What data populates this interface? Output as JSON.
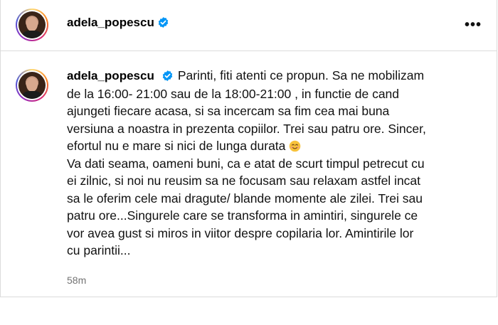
{
  "header": {
    "username": "adela_popescu",
    "more_label": "•••"
  },
  "post": {
    "username": "adela_popescu",
    "caption_lines": [
      "Parinti, fiti atenti ce propun. Sa ne mobilizam",
      "de la 16:00- 21:00 sau de la 18:00-21:00 , in functie de cand",
      "ajungeti fiecare acasa, si sa incercam sa fim cea mai buna",
      "versiuna a noastra in prezenta copiilor. Trei sau patru ore. Sincer,",
      "efortul nu e mare si nici de lunga durata",
      "Va dati seama, oameni buni, ca e atat de scurt timpul petrecut cu",
      "ei zilnic, si noi nu reusim sa ne focusam sau relaxam astfel incat",
      "sa le oferim cele mai dragute/ blande momente ale zilei. Trei sau",
      "patru ore...Singurele care se transforma in amintiri, singurele ce",
      "vor avea gust si miros in viitor despre copilaria lor. Amintirile lor",
      "cu parintii..."
    ],
    "timestamp": "58m",
    "emoji_icon": "smiling-face-icon"
  },
  "colors": {
    "verified": "#0095f6",
    "border": "#dbdbdb",
    "timestamp": "#737373"
  }
}
